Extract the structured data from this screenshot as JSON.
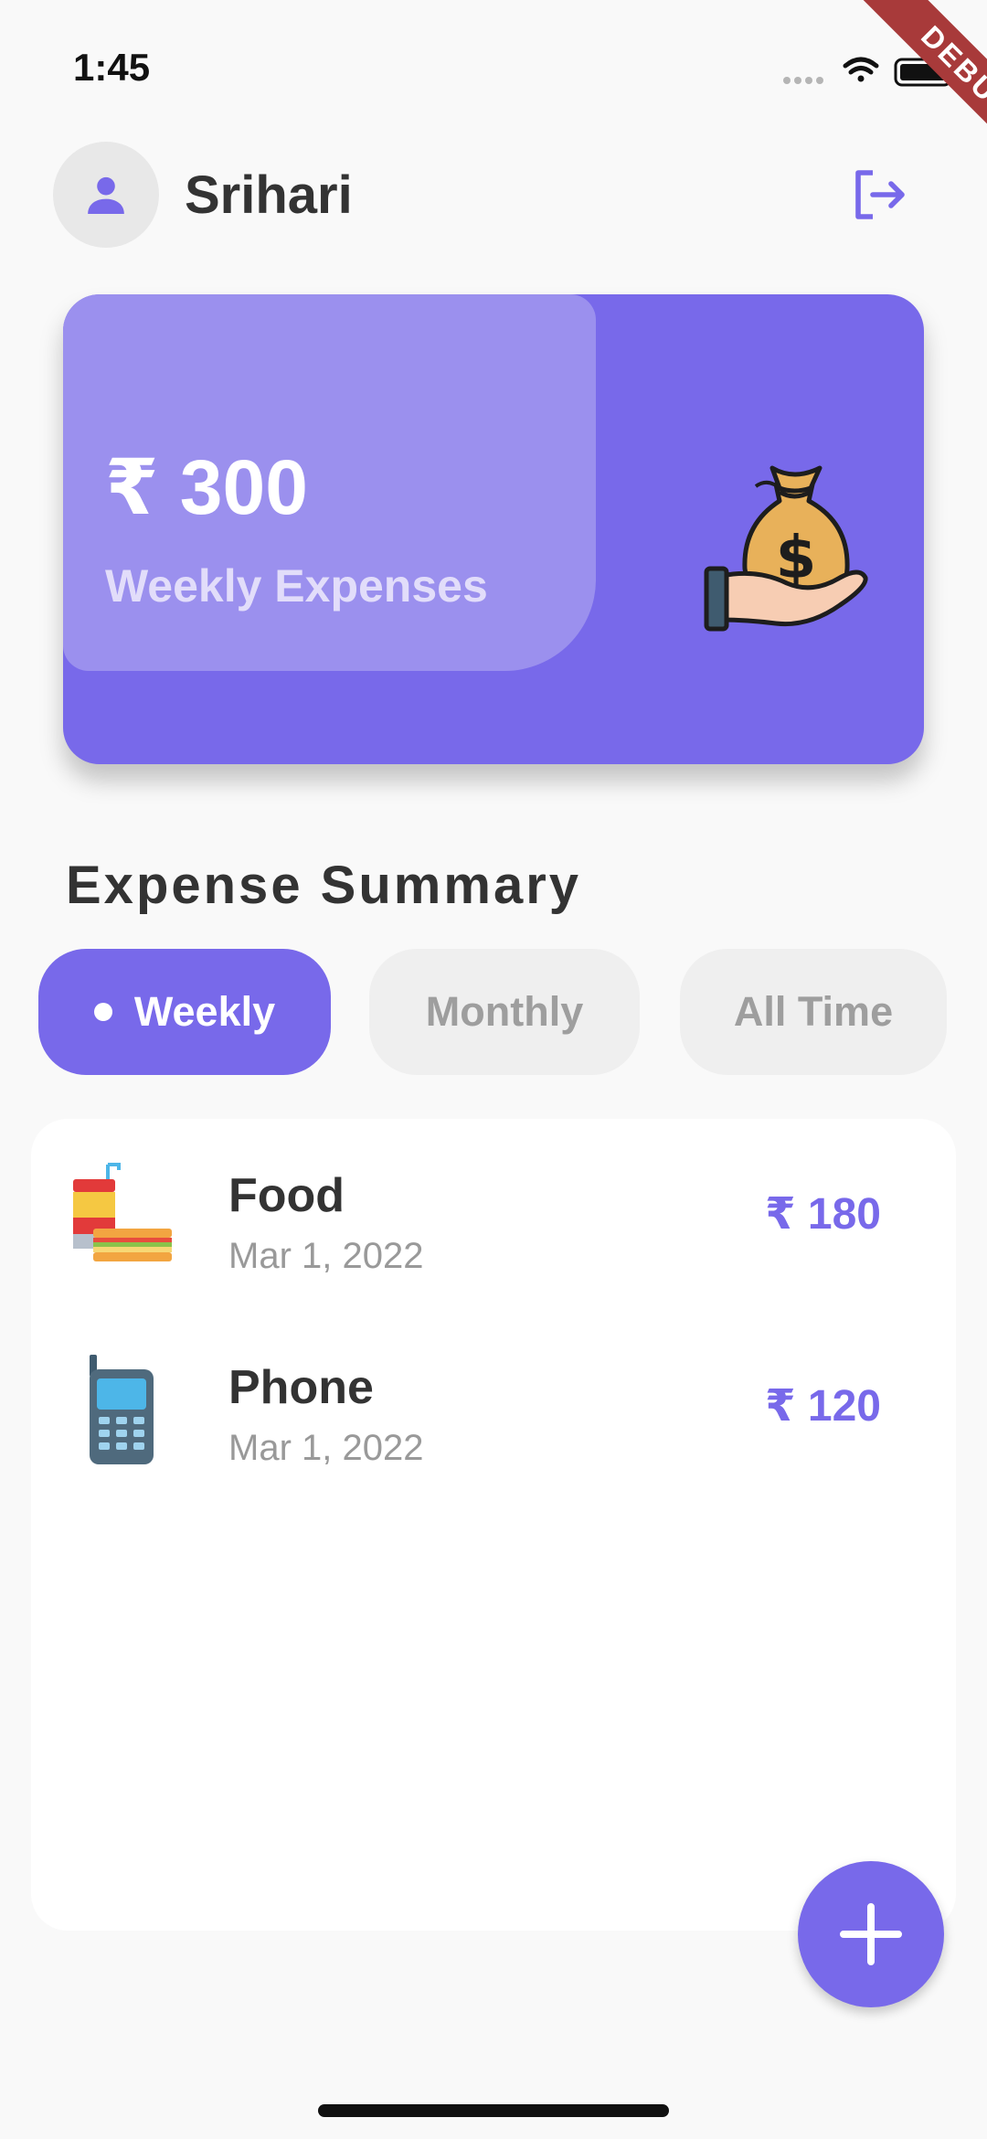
{
  "status_bar": {
    "time": "1:45"
  },
  "debug_banner": "DEBUG",
  "header": {
    "user_name": "Srihari",
    "avatar_icon": "person-icon",
    "logout_icon": "logout-icon"
  },
  "summary_card": {
    "amount": "₹ 300",
    "label": "Weekly Expenses",
    "illustration": "money-bag-in-hand"
  },
  "section_title": "Expense Summary",
  "filters": {
    "selected": "Weekly",
    "options": [
      "Weekly",
      "Monthly",
      "All Time"
    ]
  },
  "expenses": [
    {
      "title": "Food",
      "date": "Mar 1, 2022",
      "amount": "₹ 180",
      "icon": "food-icon"
    },
    {
      "title": "Phone",
      "date": "Mar 1, 2022",
      "amount": "₹ 120",
      "icon": "phone-icon"
    }
  ],
  "fab": {
    "icon": "plus-icon"
  },
  "colors": {
    "accent": "#7869ea",
    "accent_light": "#9b90ee",
    "background": "#f9f9f9",
    "text": "#333333",
    "muted": "#999999"
  }
}
